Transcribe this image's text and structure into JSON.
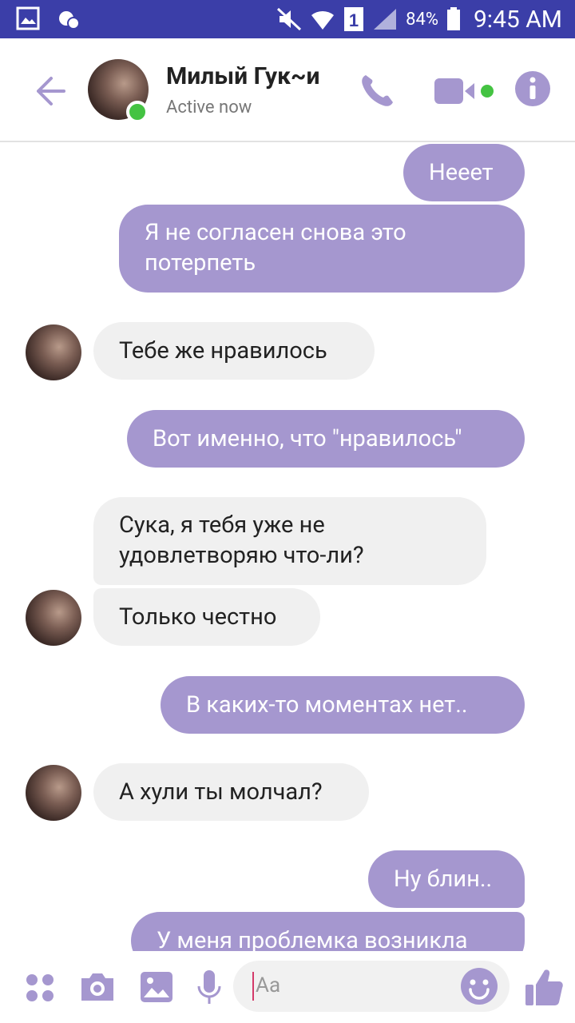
{
  "status_bar": {
    "battery": "84%",
    "time": "9:45 AM"
  },
  "header": {
    "contact_name": "Милый Гук~и",
    "contact_status": "Active now"
  },
  "messages": [
    {
      "side": "out",
      "text": "Нееет"
    },
    {
      "side": "out",
      "lines": [
        "Я не согласен снова это",
        "потерпеть"
      ]
    },
    {
      "side": "in",
      "text": "Тебе же нравилось"
    },
    {
      "side": "out",
      "text": "Вот именно, что \"нравилось\""
    },
    {
      "side": "in",
      "lines": [
        "Сука, я тебя уже не",
        "удовлетворяю что-ли?"
      ]
    },
    {
      "side": "in",
      "text": "Только честно"
    },
    {
      "side": "out",
      "text": "В каких-то моментах нет.."
    },
    {
      "side": "in",
      "text": "А хули ты молчал?"
    },
    {
      "side": "out",
      "text": "Ну блин.."
    },
    {
      "side": "out",
      "text": "У меня проблемка возникла"
    }
  ],
  "composer": {
    "placeholder": "Aa"
  },
  "colors": {
    "accent": "#a597cf",
    "status_bar": "#3b3ea8",
    "online": "#44c342"
  },
  "icons": [
    "back-arrow-icon",
    "phone-icon",
    "video-camera-icon",
    "info-icon",
    "apps-grid-icon",
    "camera-icon",
    "image-icon",
    "microphone-icon",
    "emoji-icon",
    "thumbs-up-icon"
  ]
}
